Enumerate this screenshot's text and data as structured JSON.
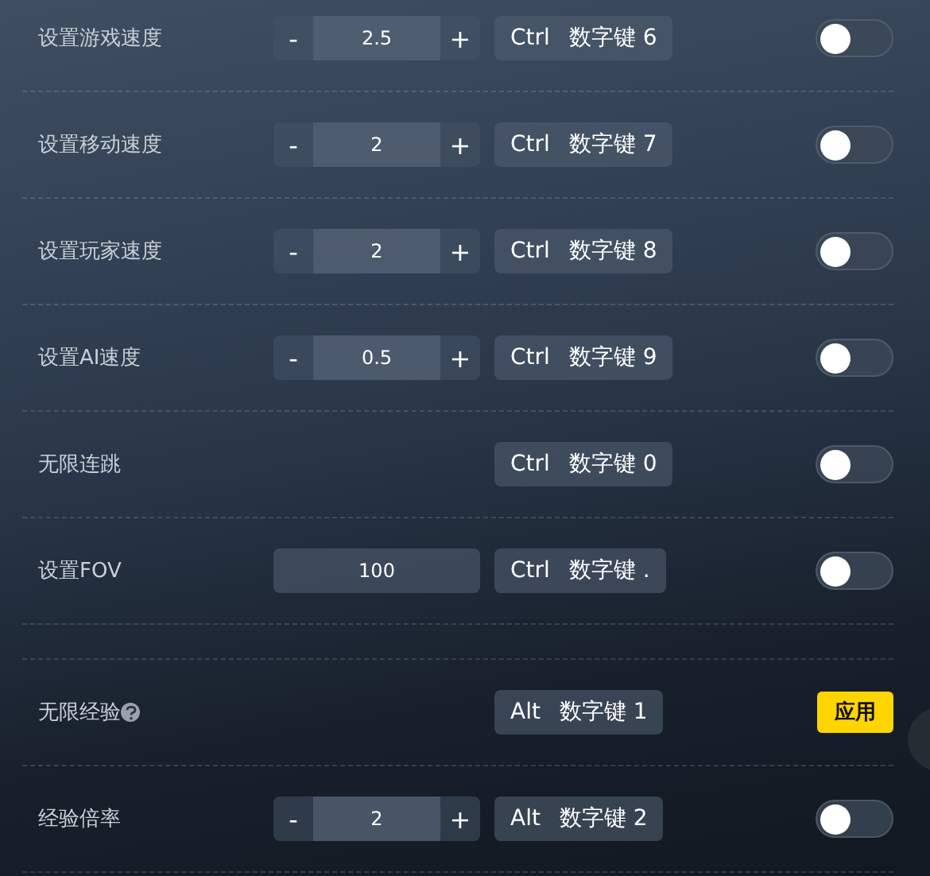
{
  "sections": [
    {
      "rows": [
        {
          "label": "设置游戏速度",
          "control": {
            "kind": "stepper",
            "minus": "-",
            "value": "2.5",
            "plus": "+"
          },
          "hotkey": {
            "modifier": "Ctrl",
            "key": "数字键 6"
          },
          "action": {
            "kind": "toggle",
            "on": false
          }
        },
        {
          "label": "设置移动速度",
          "control": {
            "kind": "stepper",
            "minus": "-",
            "value": "2",
            "plus": "+"
          },
          "hotkey": {
            "modifier": "Ctrl",
            "key": "数字键 7"
          },
          "action": {
            "kind": "toggle",
            "on": false
          }
        },
        {
          "label": "设置玩家速度",
          "control": {
            "kind": "stepper",
            "minus": "-",
            "value": "2",
            "plus": "+"
          },
          "hotkey": {
            "modifier": "Ctrl",
            "key": "数字键 8"
          },
          "action": {
            "kind": "toggle",
            "on": false
          }
        },
        {
          "label": "设置AI速度",
          "control": {
            "kind": "stepper",
            "minus": "-",
            "value": "0.5",
            "plus": "+"
          },
          "hotkey": {
            "modifier": "Ctrl",
            "key": "数字键 9"
          },
          "action": {
            "kind": "toggle",
            "on": false
          }
        },
        {
          "label": "无限连跳",
          "hotkey": {
            "modifier": "Ctrl",
            "key": "数字键 0"
          },
          "action": {
            "kind": "toggle",
            "on": false
          }
        },
        {
          "label": "设置FOV",
          "control": {
            "kind": "input",
            "value": "100"
          },
          "hotkey": {
            "modifier": "Ctrl",
            "key": "数字键 ."
          },
          "action": {
            "kind": "toggle",
            "on": false
          }
        }
      ]
    },
    {
      "rows": [
        {
          "label": "无限经验",
          "help": true,
          "hotkey": {
            "modifier": "Alt",
            "key": "数字键 1"
          },
          "action": {
            "kind": "button",
            "label": "应用"
          }
        },
        {
          "label": "经验倍率",
          "control": {
            "kind": "stepper",
            "minus": "-",
            "value": "2",
            "plus": "+"
          },
          "hotkey": {
            "modifier": "Alt",
            "key": "数字键 2"
          },
          "action": {
            "kind": "toggle",
            "on": false
          }
        }
      ]
    }
  ]
}
